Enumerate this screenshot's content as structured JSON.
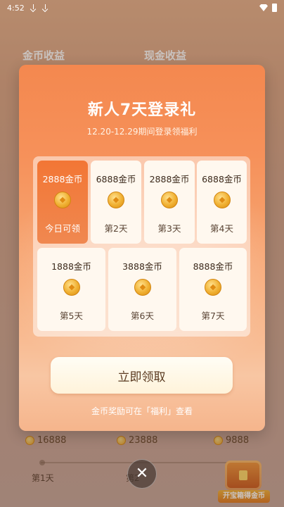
{
  "status_bar": {
    "time": "4:52"
  },
  "background": {
    "tabs": [
      "金币收益",
      "现金收益"
    ],
    "coin_values": [
      "16888",
      "23888",
      "9888"
    ],
    "day_labels": [
      "第1天",
      "第2"
    ],
    "treasure_label": "开宝箱得金币"
  },
  "modal": {
    "title": "新人7天登录礼",
    "subtitle": "12.20-12.29期间登录领福利",
    "cards": [
      {
        "amount": "2888金币",
        "label": "今日可领",
        "active": true
      },
      {
        "amount": "6888金币",
        "label": "第2天"
      },
      {
        "amount": "2888金币",
        "label": "第3天"
      },
      {
        "amount": "6888金币",
        "label": "第4天"
      },
      {
        "amount": "1888金币",
        "label": "第5天"
      },
      {
        "amount": "3888金币",
        "label": "第6天"
      },
      {
        "amount": "8888金币",
        "label": "第7天"
      }
    ],
    "claim_button": "立即领取",
    "footnote": "金币奖励可在「福利」查看",
    "close_symbol": "✕"
  },
  "colors": {
    "accent": "#f27635",
    "card_bg": "#fff8ef"
  }
}
